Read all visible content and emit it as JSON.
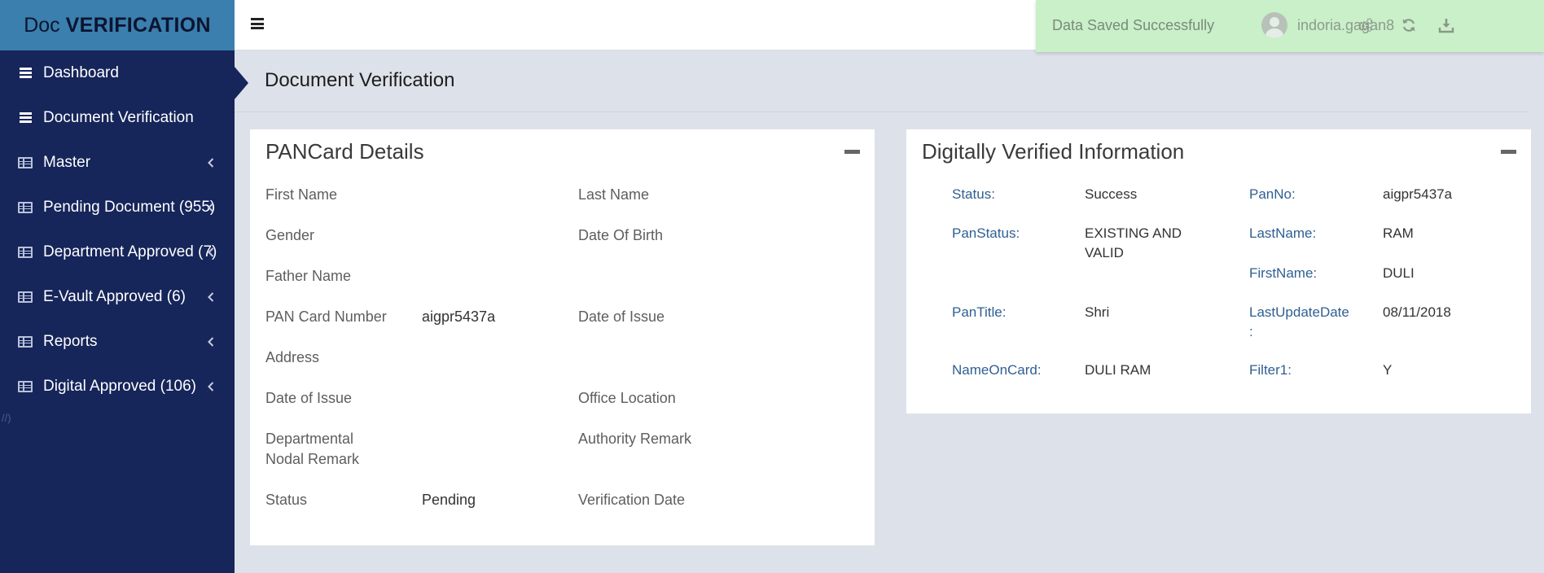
{
  "brand": {
    "part1": "Doc",
    "part2": "VERIFICATION"
  },
  "sidebar": {
    "items": [
      {
        "label": "Dashboard"
      },
      {
        "label": "Document Verification"
      },
      {
        "label": "Master"
      },
      {
        "label": "Pending Document (955)"
      },
      {
        "label": "Department Approved (7)"
      },
      {
        "label": "E-Vault Approved (6)"
      },
      {
        "label": "Reports"
      },
      {
        "label": "Digital Approved (106)"
      }
    ],
    "stray_text": "//)"
  },
  "toast": {
    "message": "Data Saved Successfully"
  },
  "user": {
    "name": "indoria.gagan8"
  },
  "icons": {
    "settings": "gears-icon",
    "refresh": "refresh-icon",
    "download": "download-icon"
  },
  "page": {
    "title": "Document Verification"
  },
  "pancard": {
    "title": "PANCard Details",
    "fields": {
      "first_name": {
        "label": "First Name",
        "value": ""
      },
      "last_name": {
        "label": "Last Name",
        "value": ""
      },
      "gender": {
        "label": "Gender",
        "value": ""
      },
      "dob": {
        "label": "Date Of Birth",
        "value": ""
      },
      "father_name": {
        "label": "Father Name",
        "value": ""
      },
      "pan_number": {
        "label": "PAN Card Number",
        "value": "aigpr5437a"
      },
      "date_of_issue_1": {
        "label": "Date of Issue",
        "value": ""
      },
      "address": {
        "label": "Address",
        "value": ""
      },
      "date_of_issue_2": {
        "label": "Date of Issue",
        "value": ""
      },
      "office_location": {
        "label": "Office Location",
        "value": ""
      },
      "dept_remark_line1": {
        "label": "Departmental"
      },
      "dept_remark_line2": {
        "label": "Nodal Remark"
      },
      "authority_remark": {
        "label": "Authority Remark",
        "value": ""
      },
      "status": {
        "label": "Status",
        "value": "Pending"
      },
      "verification_date": {
        "label": "Verification Date",
        "value": ""
      }
    }
  },
  "digital": {
    "title": "Digitally Verified Information",
    "status": {
      "label": "Status:",
      "value": "Success"
    },
    "panno": {
      "label": "PanNo:",
      "value": "aigpr5437a"
    },
    "panstatus": {
      "label": "PanStatus:",
      "value_line1": "EXISTING AND",
      "value_line2": "VALID"
    },
    "lastname": {
      "label": "LastName:",
      "value": "RAM"
    },
    "firstname": {
      "label": "FirstName:",
      "value": "DULI"
    },
    "pantitle": {
      "label": "PanTitle:",
      "value": "Shri"
    },
    "lastupdate": {
      "label_line1": "LastUpdateDate",
      "label_line2": ":",
      "value": "08/11/2018"
    },
    "nameoncard": {
      "label": "NameOnCard:",
      "value": "DULI RAM"
    },
    "filter1": {
      "label": "Filter1:",
      "value": "Y"
    }
  }
}
